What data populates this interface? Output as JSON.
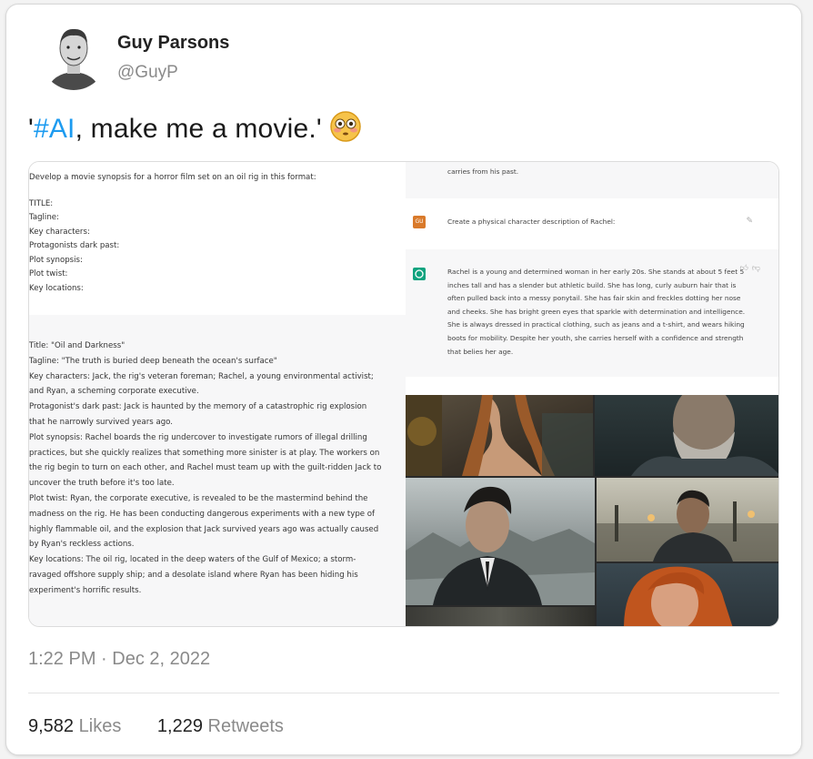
{
  "author": {
    "name": "Guy Parsons",
    "handle": "@GuyP"
  },
  "tweet": {
    "text_prefix": "'",
    "hashtag": "#AI",
    "text_rest": ", make me a movie.'",
    "emoji": "flushed-face-emoji"
  },
  "media": {
    "prompt_lines": [
      "Develop a movie synopsis for a horror film set on an oil rig in this format:",
      "",
      "TITLE:",
      "Tagline:",
      "Key characters:",
      "Protagonists dark past:",
      "Plot synopsis:",
      "Plot twist:",
      "Key locations:"
    ],
    "answer_lines": [
      "Title: \"Oil and Darkness\"",
      "Tagline: \"The truth is buried deep beneath the ocean's surface\"",
      "Key characters: Jack, the rig's veteran foreman; Rachel, a young environmental activist;",
      "and Ryan, a scheming corporate executive.",
      "Protagonist's dark past: Jack is haunted by the memory of a catastrophic rig explosion",
      "that he narrowly survived years ago.",
      "Plot synopsis: Rachel boards the rig undercover to investigate rumors of illegal drilling",
      "practices, but she quickly realizes that something more sinister is at play. The workers on",
      "the rig begin to turn on each other, and Rachel must team up with the guilt-ridden Jack to",
      "uncover the truth before it's too late.",
      "Plot twist: Ryan, the corporate executive, is revealed to be the mastermind behind the",
      "madness on the rig. He has been conducting dangerous experiments with a new type of",
      "highly flammable oil, and the explosion that Jack survived years ago was actually caused",
      "by Ryan's reckless actions.",
      "Key locations: The oil rig, located in the deep waters of the Gulf of Mexico; a storm-",
      "ravaged offshore supply ship; and a desolate island where Ryan has been hiding his",
      "experiment's horrific results."
    ],
    "carry_text": "carries from his past.",
    "question": "Create a physical character description of Rachel:",
    "user_badge": "GU",
    "rachel_lines": [
      "Rachel is a young and determined woman in her early 20s. She stands at about 5 feet 5",
      "inches tall and has a slender but athletic build. She has long, curly auburn hair that is",
      "often pulled back into a messy ponytail. She has fair skin and freckles dotting her nose",
      "and cheeks. She has bright green eyes that sparkle with determination and intelligence.",
      "She is always dressed in practical clothing, such as jeans and a t-shirt, and wears hiking",
      "boots for mobility. Despite her youth, she carries herself with a confidence and strength",
      "that belies her age."
    ]
  },
  "meta": {
    "timestamp": "1:22 PM · Dec 2, 2022",
    "likes_count": "9,582",
    "likes_label": "Likes",
    "retweets_count": "1,229",
    "retweets_label": "Retweets"
  },
  "colors": {
    "hashtag": "#1d9bf0",
    "user_badge": "#d97a2b",
    "assistant_badge": "#10a37f"
  }
}
